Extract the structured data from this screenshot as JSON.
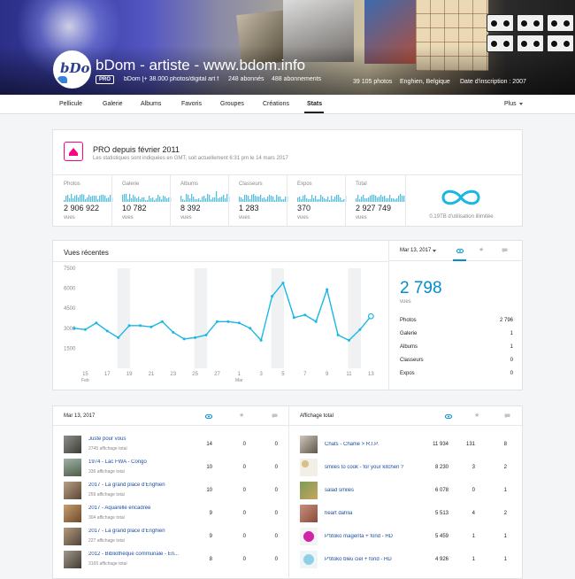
{
  "profile": {
    "name": "bDom - artiste - www.bdom.info",
    "pro_badge": "PRO",
    "description": "bDom [+ 38.000 photos/digital art f...",
    "followers": "248 abonnés",
    "following": "488 abonnements",
    "photos": "39 105 photos",
    "location": "Enghien, Belgique",
    "joined": "Date d'inscription : 2007",
    "avatar_text": "bDom"
  },
  "nav": {
    "items": [
      "Pellicule",
      "Galerie",
      "Albums",
      "Favoris",
      "Groupes",
      "Créations",
      "Stats"
    ],
    "active": "Stats",
    "more": "Plus"
  },
  "pro": {
    "title": "PRO depuis février 2011",
    "subtitle": "Les statistiques sont indiquées en GMT, soit actuellement 6:31 pm le 14 mars 2017",
    "stats": [
      {
        "label": "Photos",
        "value": "2 906 922",
        "unit": "vues"
      },
      {
        "label": "Galerie",
        "value": "10 782",
        "unit": "vues"
      },
      {
        "label": "Albums",
        "value": "8 392",
        "unit": "vues"
      },
      {
        "label": "Classeurs",
        "value": "1 283",
        "unit": "vues"
      },
      {
        "label": "Expos",
        "value": "370",
        "unit": "vues"
      },
      {
        "label": "Total",
        "value": "2 927 749",
        "unit": "vues"
      }
    ],
    "usage": "0.19TB d'utilisation illimitée",
    "accent_color": "#ff0084",
    "spark_color": "#5bc0de"
  },
  "recent": {
    "title": "Vues récentes",
    "date": "Mar 13, 2017",
    "total": "2 798",
    "unit": "vues",
    "breakdown": [
      {
        "label": "Photos",
        "value": "2 796"
      },
      {
        "label": "Galerie",
        "value": "1"
      },
      {
        "label": "Albums",
        "value": "1"
      },
      {
        "label": "Classeurs",
        "value": "0"
      },
      {
        "label": "Expos",
        "value": "0"
      }
    ],
    "line_color": "#1ab7e6"
  },
  "chart_data": {
    "type": "line",
    "title": "Vues récentes",
    "x_tick_labels": [
      "15",
      "17",
      "19",
      "21",
      "23",
      "25",
      "27",
      "1",
      "3",
      "5",
      "7",
      "9",
      "11",
      "13"
    ],
    "x_month_labels": [
      {
        "at": "15",
        "text": "Feb"
      },
      {
        "at": "1",
        "text": "Mar"
      }
    ],
    "y_ticks": [
      1500,
      3000,
      4500,
      6000,
      7500
    ],
    "ylim": [
      0,
      7500
    ],
    "series": [
      {
        "x": [
          "Feb 14",
          "Feb 15",
          "Feb 16",
          "Feb 17",
          "Feb 18",
          "Feb 19",
          "Feb 20",
          "Feb 21",
          "Feb 22",
          "Feb 23",
          "Feb 24",
          "Feb 25",
          "Feb 26",
          "Feb 27",
          "Feb 28",
          "Mar 1",
          "Mar 2",
          "Mar 3",
          "Mar 4",
          "Mar 5",
          "Mar 6",
          "Mar 7",
          "Mar 8",
          "Mar 9",
          "Mar 10",
          "Mar 11",
          "Mar 12",
          "Mar 13",
          "Mar 14"
        ],
        "values": [
          3000,
          2900,
          3400,
          2800,
          2300,
          3200,
          3200,
          3100,
          3500,
          2700,
          2200,
          2300,
          2500,
          3500,
          3500,
          3400,
          3000,
          2100,
          5400,
          6400,
          3800,
          4000,
          3500,
          5900,
          2500,
          2100,
          2900,
          3900,
          0
        ],
        "highlight_index": 27
      }
    ],
    "weekend_bands": [
      "Feb 18-19",
      "Feb 25-26",
      "Mar 4-5",
      "Mar 11-12"
    ],
    "grid": false
  },
  "table": {
    "left_header": "Mar 13, 2017",
    "right_header": "Affichage total",
    "left_rows": [
      {
        "title": "Juste pour vous",
        "sub": "2745 affichage total",
        "views": "14",
        "faves": "0",
        "comments": "0"
      },
      {
        "title": "1974 - Lac FWA - Congo",
        "sub": "336 affichage total",
        "views": "10",
        "faves": "0",
        "comments": "0"
      },
      {
        "title": "2017 - La grand place d'Enghien",
        "sub": "259 affichage total",
        "views": "10",
        "faves": "0",
        "comments": "0"
      },
      {
        "title": "2017 - Aquarelle encadrée",
        "sub": "304 affichage total",
        "views": "9",
        "faves": "0",
        "comments": "0"
      },
      {
        "title": "2017 - La grand place d'Enghien",
        "sub": "227 affichage total",
        "views": "9",
        "faves": "0",
        "comments": "0"
      },
      {
        "title": "2012 - Bibliothèque communale - En...",
        "sub": "3165 affichage total",
        "views": "8",
        "faves": "0",
        "comments": "0"
      }
    ],
    "right_rows": [
      {
        "title": "Chats - Charlie > R.I.P.",
        "views": "11 934",
        "faves": "131",
        "comments": "8"
      },
      {
        "title": "smiles to cook - for your kitchen ?",
        "views": "8 230",
        "faves": "3",
        "comments": "2"
      },
      {
        "title": "salad smiles",
        "views": "6 078",
        "faves": "0",
        "comments": "1"
      },
      {
        "title": "heart dahlia",
        "views": "5 513",
        "faves": "4",
        "comments": "2"
      },
      {
        "title": "P'titoko magenta + fond - HD",
        "views": "5 459",
        "faves": "1",
        "comments": "1"
      },
      {
        "title": "P'titoko bleu ciel + fond - HD",
        "views": "4 926",
        "faves": "1",
        "comments": "1"
      }
    ]
  }
}
